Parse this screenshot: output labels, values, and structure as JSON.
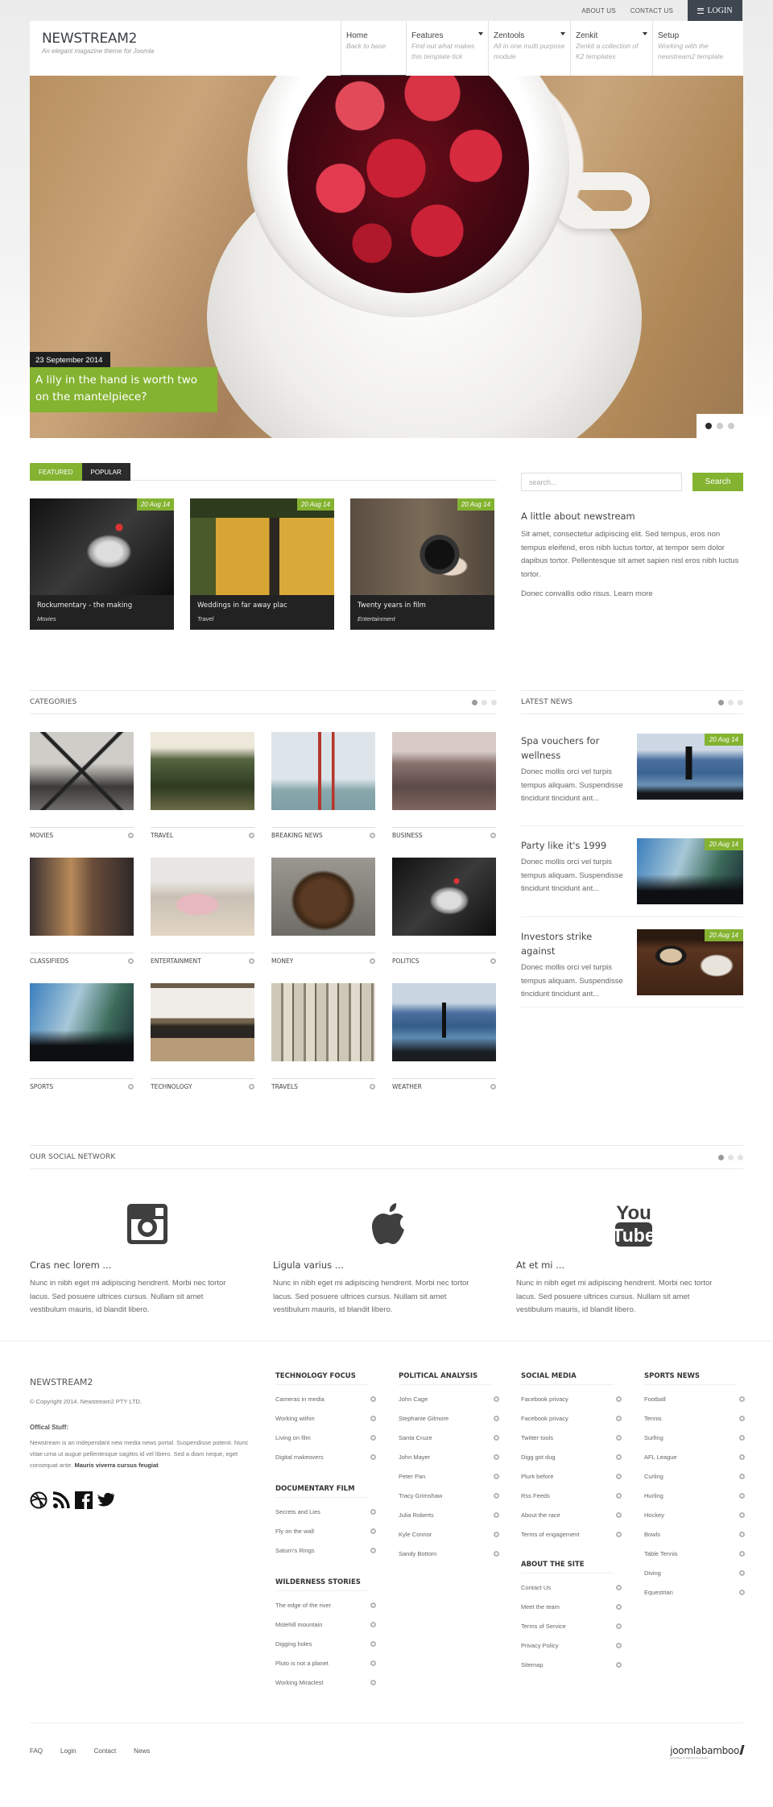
{
  "topbar": {
    "links": [
      "ABOUT US",
      "CONTACT US"
    ],
    "login_label": "LOGIN"
  },
  "header": {
    "logo_title": "NEWSTREAM2",
    "logo_subtitle": "An elegant magazine theme for Joomla",
    "nav": [
      {
        "label": "Home",
        "desc": "Back to base",
        "active": true,
        "dropdown": false
      },
      {
        "label": "Features",
        "desc": "Find out what makes this template tick",
        "active": false,
        "dropdown": true
      },
      {
        "label": "Zentools",
        "desc": "All in one multi purpose module",
        "active": false,
        "dropdown": true
      },
      {
        "label": "Zenkit",
        "desc": "Zenkit a collection of K2 templates",
        "active": false,
        "dropdown": true
      },
      {
        "label": "Setup",
        "desc": "Working with the newstream2 template",
        "active": false,
        "dropdown": false
      }
    ]
  },
  "hero": {
    "date": "23 September 2014",
    "caption": "A lily in the hand is worth two on the mantelpiece?",
    "slides": 3,
    "active_slide": 1
  },
  "tabs": {
    "items": [
      "FEATURED",
      "POPULAR"
    ],
    "active": "FEATURED"
  },
  "featured": [
    {
      "title": "Rockumentary - the making",
      "category": "Movies",
      "date": "20 Aug 14"
    },
    {
      "title": "Weddings in far away plac",
      "category": "Travel",
      "date": "20 Aug 14"
    },
    {
      "title": "Twenty years in film",
      "category": "Entertainment",
      "date": "20 Aug 14"
    }
  ],
  "sidebar": {
    "search_placeholder": "search...",
    "search_button": "Search",
    "about_title": "A little about newstream",
    "about_text": "Sit amet, consectetur adipiscing elit. Sed tempus, eros non tempus eleifend, eros nibh luctus tortor, at tempor sem dolor dapibus tortor. Pellentesque sit amet sapien nisl eros nibh luctus tortor.",
    "about_more": "Donec convallis odio risus. Learn more"
  },
  "categories": {
    "title": "CATEGORIES",
    "items": [
      "MOVIES",
      "TRAVEL",
      "BREAKING NEWS",
      "BUSINESS",
      "CLASSIFIEDS",
      "ENTERTAINMENT",
      "MONEY",
      "POLITICS",
      "SPORTS",
      "TECHNOLOGY",
      "TRAVELS",
      "WEATHER"
    ]
  },
  "latest_news": {
    "title": "LATEST NEWS",
    "items": [
      {
        "title": "Spa vouchers for wellness",
        "text": "Donec mollis orci vel turpis tempus aliquam. Suspendisse tincidunt tincidunt ant...",
        "date": "20 Aug 14"
      },
      {
        "title": "Party like it's 1999",
        "text": "Donec mollis orci vel turpis tempus aliquam. Suspendisse tincidunt tincidunt ant...",
        "date": "20 Aug 14"
      },
      {
        "title": "Investors strike against",
        "text": "Donec mollis orci vel turpis tempus aliquam. Suspendisse tincidunt tincidunt ant...",
        "date": "20 Aug 14"
      }
    ]
  },
  "social": {
    "title": "OUR SOCIAL NETWORK",
    "items": [
      {
        "icon": "instagram-icon",
        "title": "Cras nec lorem ...",
        "text": "Nunc in nibh eget mi adipiscing hendrerit. Morbi nec tortor lacus. Sed posuere ultrices cursus. Nullam sit amet vestibulum mauris, id blandit libero."
      },
      {
        "icon": "apple-icon",
        "title": "Ligula varius  ...",
        "text": "Nunc in nibh eget mi adipiscing hendrerit. Morbi nec tortor lacus. Sed posuere ultrices cursus. Nullam sit amet vestibulum mauris, id blandit libero."
      },
      {
        "icon": "youtube-icon",
        "title": "At et mi ...",
        "text": "Nunc in nibh eget mi adipiscing hendrerit. Morbi nec tortor lacus. Sed posuere ultrices cursus. Nullam sit amet vestibulum mauris, id blandit libero."
      }
    ],
    "youtube_top": "You",
    "youtube_bottom": "Tube"
  },
  "footer": {
    "brand": "NEWSTREAM2",
    "copyright": "© Copyright 2014. Newstream2 PTY LTD.",
    "official_label": "Offical Stuff:",
    "description": "Newstream is an independant new media news portal. Suspendisse potenti. Nunc vitae urna ut augue pellentesque sagittis id vel libero. Sed a diam neque, eget consequat ante. ",
    "description_bold": "Mauris viverra cursus feugiat",
    "menus": [
      {
        "title": "TECHNOLOGY FOCUS",
        "items": [
          "Cameras in media",
          "Working within",
          "Living on film",
          "Digital makeovers"
        ]
      },
      {
        "title": "DOCUMENTARY FILM",
        "items": [
          "Secrets and Lies",
          "Fly on the wall",
          "Saturn's Rings"
        ]
      },
      {
        "title": "WILDERNESS STORIES",
        "items": [
          "The edge of the river",
          "Molehill mountain",
          "Digging holes",
          "Pluto is not a planet",
          "Working Miraclest"
        ]
      },
      {
        "title": "POLITICAL ANALYSIS",
        "items": [
          "John Cage",
          "Stephanie Gilmore",
          "Santa Cruze",
          "John Mayer",
          "Peter Pan",
          "Tracy Grimshaw",
          "Julia Roberts",
          "Kyle Connor",
          "Sandy Bottom"
        ]
      },
      {
        "title": "SOCIAL MEDIA",
        "items": [
          "Facebook privacy",
          "Facebook privacy",
          "Twitter tools",
          "Digg got dug",
          "Plurk before",
          "Rss Feeds",
          "About the race",
          "Terms of engagement"
        ]
      },
      {
        "title": "ABOUT THE SITE",
        "items": [
          "Contact Us",
          "Meet the team",
          "Terms of Service",
          "Privacy Policy",
          "Sitemap"
        ]
      },
      {
        "title": "SPORTS NEWS",
        "items": [
          "Football",
          "Tennis",
          "Surfing",
          "AFL League",
          "Curling",
          "Hurling",
          "Hockey",
          "Bowls",
          "Table Tennis",
          "Diving",
          "Equestrian"
        ]
      }
    ],
    "bottom_links": [
      "FAQ",
      "Login",
      "Contact",
      "News"
    ],
    "partner_logo": "joomlabamboo",
    "partner_tagline": "templates & themes for joomla"
  },
  "colors": {
    "accent": "#84b331",
    "dark": "#2b2b2b",
    "login_bg": "#3e4650"
  }
}
